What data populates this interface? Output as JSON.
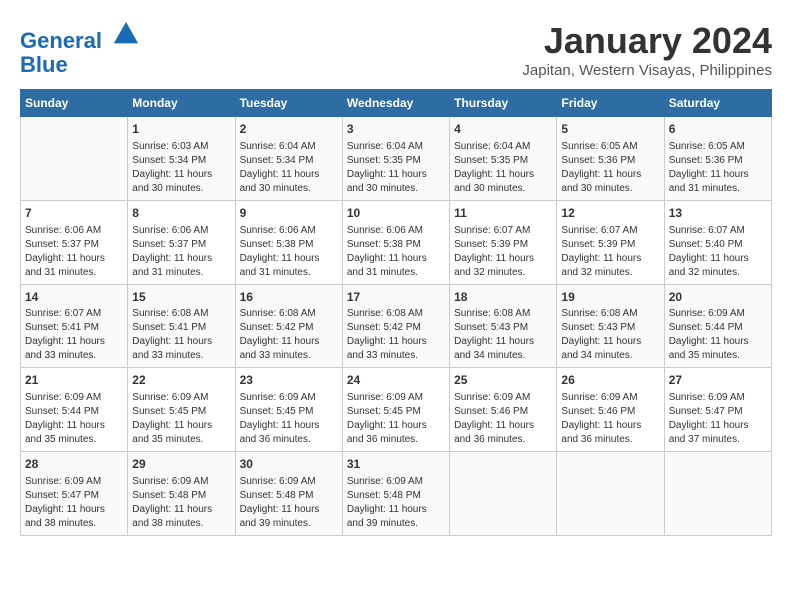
{
  "header": {
    "logo_line1": "General",
    "logo_line2": "Blue",
    "month_title": "January 2024",
    "location": "Japitan, Western Visayas, Philippines"
  },
  "days_of_week": [
    "Sunday",
    "Monday",
    "Tuesday",
    "Wednesday",
    "Thursday",
    "Friday",
    "Saturday"
  ],
  "weeks": [
    [
      {
        "day": "",
        "info": ""
      },
      {
        "day": "1",
        "info": "Sunrise: 6:03 AM\nSunset: 5:34 PM\nDaylight: 11 hours\nand 30 minutes."
      },
      {
        "day": "2",
        "info": "Sunrise: 6:04 AM\nSunset: 5:34 PM\nDaylight: 11 hours\nand 30 minutes."
      },
      {
        "day": "3",
        "info": "Sunrise: 6:04 AM\nSunset: 5:35 PM\nDaylight: 11 hours\nand 30 minutes."
      },
      {
        "day": "4",
        "info": "Sunrise: 6:04 AM\nSunset: 5:35 PM\nDaylight: 11 hours\nand 30 minutes."
      },
      {
        "day": "5",
        "info": "Sunrise: 6:05 AM\nSunset: 5:36 PM\nDaylight: 11 hours\nand 30 minutes."
      },
      {
        "day": "6",
        "info": "Sunrise: 6:05 AM\nSunset: 5:36 PM\nDaylight: 11 hours\nand 31 minutes."
      }
    ],
    [
      {
        "day": "7",
        "info": "Sunrise: 6:06 AM\nSunset: 5:37 PM\nDaylight: 11 hours\nand 31 minutes."
      },
      {
        "day": "8",
        "info": "Sunrise: 6:06 AM\nSunset: 5:37 PM\nDaylight: 11 hours\nand 31 minutes."
      },
      {
        "day": "9",
        "info": "Sunrise: 6:06 AM\nSunset: 5:38 PM\nDaylight: 11 hours\nand 31 minutes."
      },
      {
        "day": "10",
        "info": "Sunrise: 6:06 AM\nSunset: 5:38 PM\nDaylight: 11 hours\nand 31 minutes."
      },
      {
        "day": "11",
        "info": "Sunrise: 6:07 AM\nSunset: 5:39 PM\nDaylight: 11 hours\nand 32 minutes."
      },
      {
        "day": "12",
        "info": "Sunrise: 6:07 AM\nSunset: 5:39 PM\nDaylight: 11 hours\nand 32 minutes."
      },
      {
        "day": "13",
        "info": "Sunrise: 6:07 AM\nSunset: 5:40 PM\nDaylight: 11 hours\nand 32 minutes."
      }
    ],
    [
      {
        "day": "14",
        "info": "Sunrise: 6:07 AM\nSunset: 5:41 PM\nDaylight: 11 hours\nand 33 minutes."
      },
      {
        "day": "15",
        "info": "Sunrise: 6:08 AM\nSunset: 5:41 PM\nDaylight: 11 hours\nand 33 minutes."
      },
      {
        "day": "16",
        "info": "Sunrise: 6:08 AM\nSunset: 5:42 PM\nDaylight: 11 hours\nand 33 minutes."
      },
      {
        "day": "17",
        "info": "Sunrise: 6:08 AM\nSunset: 5:42 PM\nDaylight: 11 hours\nand 33 minutes."
      },
      {
        "day": "18",
        "info": "Sunrise: 6:08 AM\nSunset: 5:43 PM\nDaylight: 11 hours\nand 34 minutes."
      },
      {
        "day": "19",
        "info": "Sunrise: 6:08 AM\nSunset: 5:43 PM\nDaylight: 11 hours\nand 34 minutes."
      },
      {
        "day": "20",
        "info": "Sunrise: 6:09 AM\nSunset: 5:44 PM\nDaylight: 11 hours\nand 35 minutes."
      }
    ],
    [
      {
        "day": "21",
        "info": "Sunrise: 6:09 AM\nSunset: 5:44 PM\nDaylight: 11 hours\nand 35 minutes."
      },
      {
        "day": "22",
        "info": "Sunrise: 6:09 AM\nSunset: 5:45 PM\nDaylight: 11 hours\nand 35 minutes."
      },
      {
        "day": "23",
        "info": "Sunrise: 6:09 AM\nSunset: 5:45 PM\nDaylight: 11 hours\nand 36 minutes."
      },
      {
        "day": "24",
        "info": "Sunrise: 6:09 AM\nSunset: 5:45 PM\nDaylight: 11 hours\nand 36 minutes."
      },
      {
        "day": "25",
        "info": "Sunrise: 6:09 AM\nSunset: 5:46 PM\nDaylight: 11 hours\nand 36 minutes."
      },
      {
        "day": "26",
        "info": "Sunrise: 6:09 AM\nSunset: 5:46 PM\nDaylight: 11 hours\nand 36 minutes."
      },
      {
        "day": "27",
        "info": "Sunrise: 6:09 AM\nSunset: 5:47 PM\nDaylight: 11 hours\nand 37 minutes."
      }
    ],
    [
      {
        "day": "28",
        "info": "Sunrise: 6:09 AM\nSunset: 5:47 PM\nDaylight: 11 hours\nand 38 minutes."
      },
      {
        "day": "29",
        "info": "Sunrise: 6:09 AM\nSunset: 5:48 PM\nDaylight: 11 hours\nand 38 minutes."
      },
      {
        "day": "30",
        "info": "Sunrise: 6:09 AM\nSunset: 5:48 PM\nDaylight: 11 hours\nand 39 minutes."
      },
      {
        "day": "31",
        "info": "Sunrise: 6:09 AM\nSunset: 5:48 PM\nDaylight: 11 hours\nand 39 minutes."
      },
      {
        "day": "",
        "info": ""
      },
      {
        "day": "",
        "info": ""
      },
      {
        "day": "",
        "info": ""
      }
    ]
  ]
}
